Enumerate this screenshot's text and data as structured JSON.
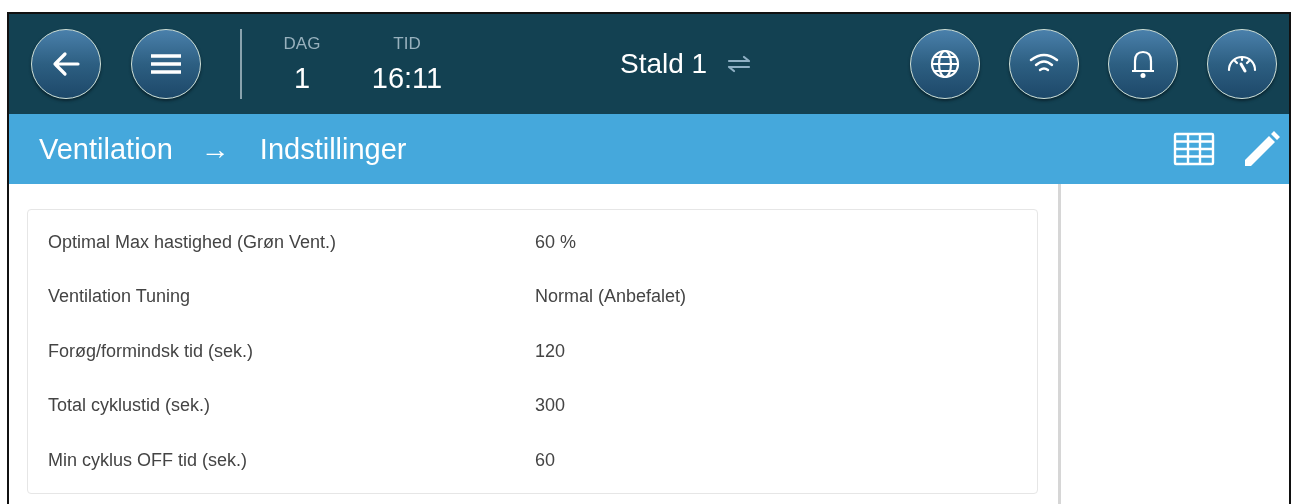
{
  "header": {
    "day_label": "DAG",
    "day": "1",
    "time_label": "TID",
    "time": "16:11",
    "house": "Stald 1"
  },
  "breadcrumb": {
    "section": "Ventilation",
    "arrow": "→",
    "page": "Indstillinger"
  },
  "settings": [
    {
      "label": "Optimal Max hastighed (Grøn Vent.)",
      "value": "60 %"
    },
    {
      "label": "Ventilation Tuning",
      "value": "Normal (Anbefalet)"
    },
    {
      "label": "Forøg/formindsk tid (sek.)",
      "value": "120"
    },
    {
      "label": "Total cyklustid (sek.)",
      "value": "300"
    },
    {
      "label": "Min cyklus OFF tid (sek.)",
      "value": "60"
    }
  ]
}
